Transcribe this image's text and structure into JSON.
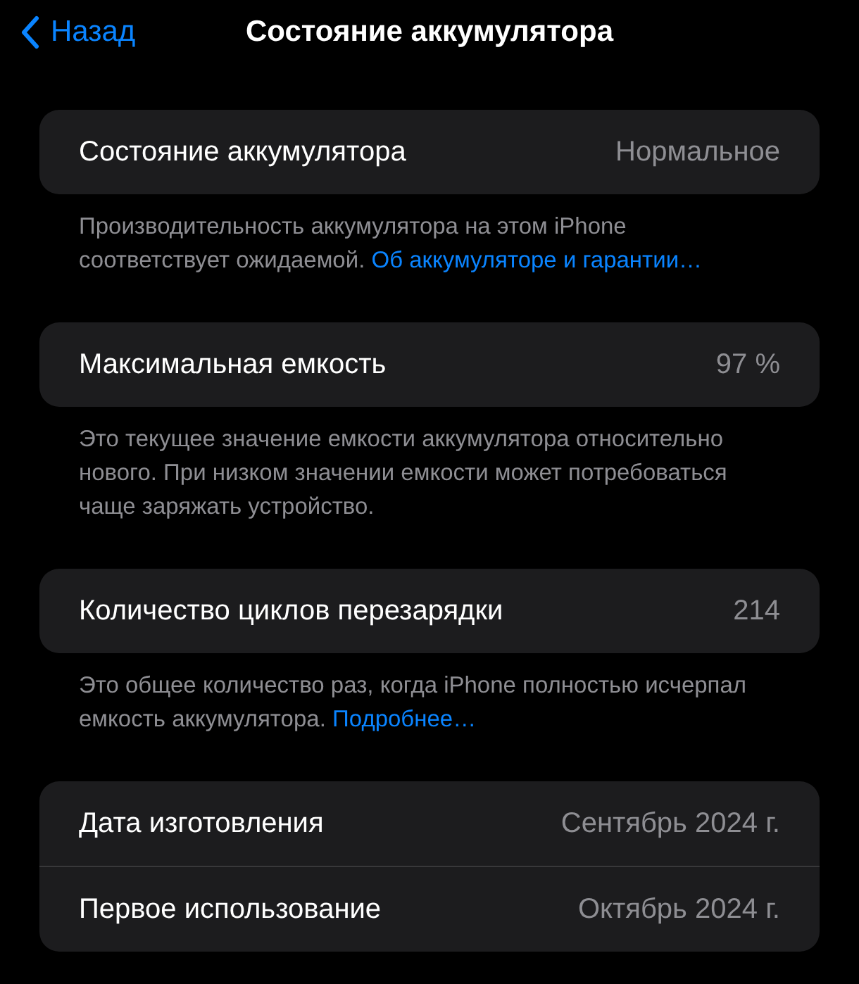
{
  "nav": {
    "back": "Назад",
    "title": "Состояние аккумулятора"
  },
  "sections": [
    {
      "rows": [
        {
          "label": "Состояние аккумулятора",
          "value": "Нормальное"
        }
      ],
      "footer": {
        "text": "Производительность аккумулятора на этом iPhone соответствует ожидаемой.",
        "link": "Об аккумуляторе и гарантии…"
      }
    },
    {
      "rows": [
        {
          "label": "Максимальная емкость",
          "value": "97 %"
        }
      ],
      "footer": {
        "text": "Это текущее значение емкости аккумулятора относительно нового. При низком значении емкости может потребоваться чаще заряжать устройство."
      }
    },
    {
      "rows": [
        {
          "label": "Количество циклов перезарядки",
          "value": "214"
        }
      ],
      "footer": {
        "text": "Это общее количество раз, когда iPhone полностью исчерпал емкость аккумулятора.",
        "link": "Подробнее…"
      }
    },
    {
      "rows": [
        {
          "label": "Дата изготовления",
          "value": "Сентябрь 2024 г."
        },
        {
          "label": "Первое использование",
          "value": "Октябрь 2024 г."
        }
      ]
    }
  ]
}
